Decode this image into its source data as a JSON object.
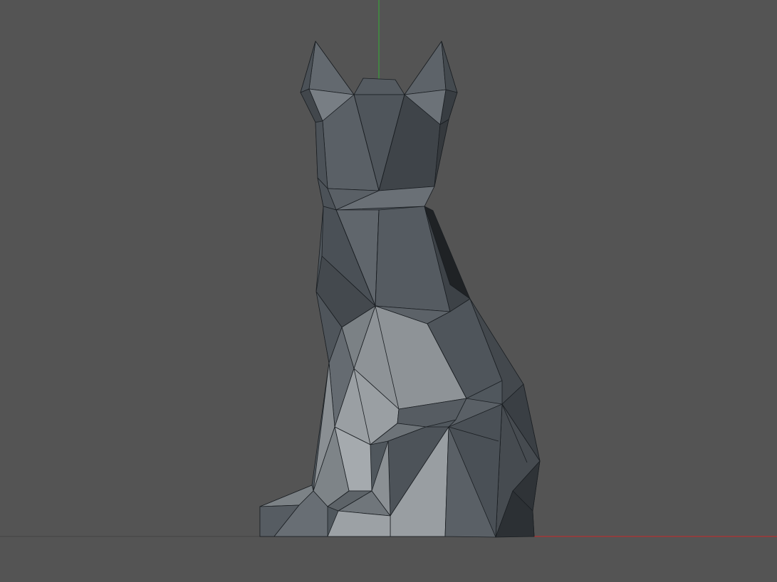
{
  "viewport": {
    "background_color": "#545454",
    "ground_line_color": "#444444",
    "x_axis_color": "#b03030",
    "y_axis_color": "#3aa03a",
    "model_colors": {
      "dark": "#3b4045",
      "mid_dark": "#4a5056",
      "mid": "#5b6268",
      "light": "#70777d",
      "lighter": "#888d91",
      "lightest": "#999ea2",
      "edge": "#1a1e22"
    },
    "model_icon": "low-poly-cat-mesh"
  }
}
